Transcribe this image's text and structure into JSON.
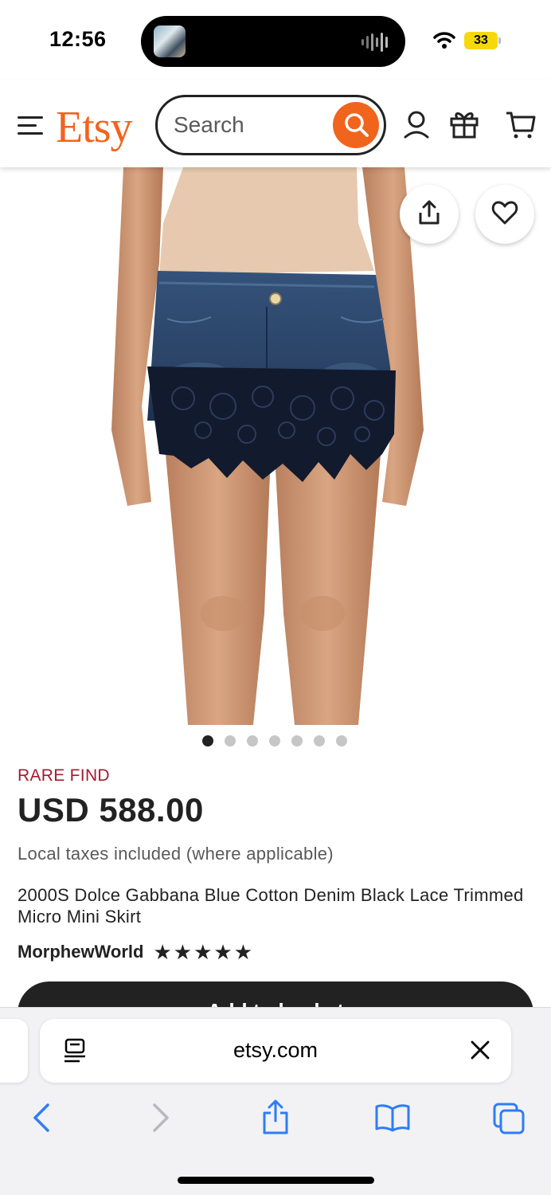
{
  "status_bar": {
    "time": "12:56",
    "battery": "33"
  },
  "header": {
    "logo": "Etsy",
    "search_placeholder": "Search",
    "brand_color": "#F1641E"
  },
  "gallery": {
    "image_count": 7,
    "active_index": 0
  },
  "product": {
    "badge": "RARE FIND",
    "price": "USD 588.00",
    "tax_note": "Local taxes included (where applicable)",
    "title": "2000S Dolce Gabbana Blue Cotton Denim Black Lace Trimmed Micro Mini Skirt",
    "shop_name": "MorphewWorld",
    "rating_stars": 5,
    "add_button_label": "Add to basket"
  },
  "browser": {
    "url": "etsy.com"
  }
}
